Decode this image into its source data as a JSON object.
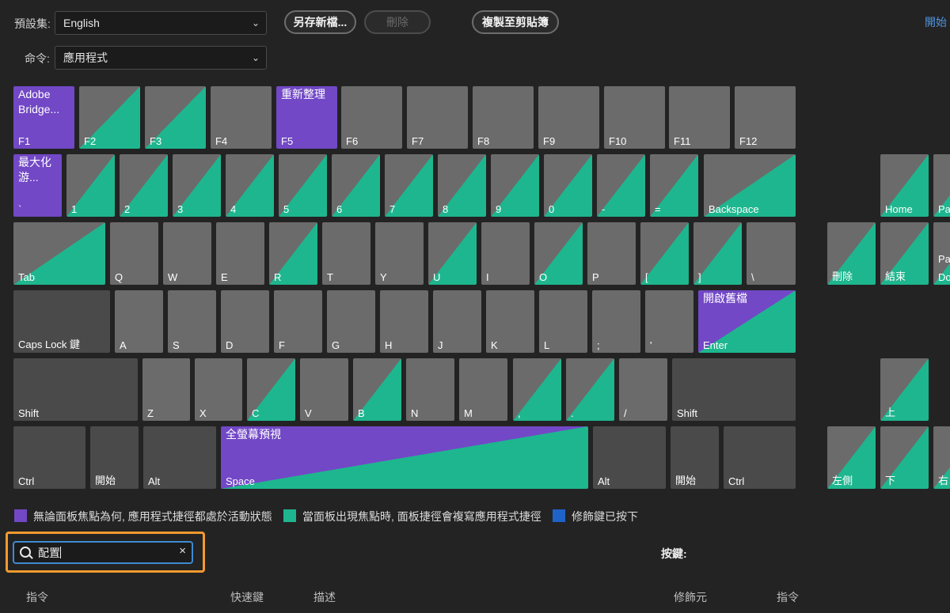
{
  "toolbar": {
    "preset_label": "預設集:",
    "preset_value": "English",
    "command_label": "命令:",
    "command_value": "應用程式",
    "save_as": "另存新檔...",
    "delete": "刪除",
    "copy_clipboard": "複製至剪貼簿",
    "start_link": "開始"
  },
  "keys": {
    "f1": "F1",
    "f1_cmd": "Adobe Bridge...",
    "f2": "F2",
    "f3": "F3",
    "f4": "F4",
    "f5": "F5",
    "f5_cmd": "重新整理",
    "f6": "F6",
    "f7": "F7",
    "f8": "F8",
    "f9": "F9",
    "f10": "F10",
    "f11": "F11",
    "f12": "F12",
    "grave": "`",
    "grave_cmd": "最大化游...",
    "n1": "1",
    "n2": "2",
    "n3": "3",
    "n4": "4",
    "n5": "5",
    "n6": "6",
    "n7": "7",
    "n8": "8",
    "n9": "9",
    "n0": "0",
    "minus": "-",
    "equal": "=",
    "backspace": "Backspace",
    "tab": "Tab",
    "q": "Q",
    "w": "W",
    "e": "E",
    "r": "R",
    "t": "T",
    "y": "Y",
    "u": "U",
    "i": "I",
    "o": "O",
    "p": "P",
    "lbracket": "[",
    "rbracket": "]",
    "backslash": "\\",
    "caps": "Caps Lock 鍵",
    "a": "A",
    "s": "S",
    "d": "D",
    "f": "F",
    "g": "G",
    "h": "H",
    "j": "J",
    "k": "K",
    "l": "L",
    "semicolon": ";",
    "quote": "'",
    "enter": "Enter",
    "enter_cmd": "開啟舊檔",
    "lshift": "Shift",
    "z": "Z",
    "x": "X",
    "c": "C",
    "v": "V",
    "b": "B",
    "n": "N",
    "m": "M",
    "comma": ",",
    "period": ".",
    "slash": "/",
    "rshift": "Shift",
    "lctrl": "Ctrl",
    "lwin": "開始",
    "lalt": "Alt",
    "space": "Space",
    "space_cmd": "全螢幕預視",
    "ralt": "Alt",
    "rwin": "開始",
    "rctrl": "Ctrl",
    "home": "Home",
    "pgup": "Pa",
    "del": "刪除",
    "end": "結束",
    "pgdn_top": "Pag",
    "pgdn_bot": "Do",
    "up": "上",
    "left": "左側",
    "down": "下",
    "right": "右"
  },
  "legend": {
    "app": "無論面板焦點為何, 應用程式捷徑都處於活動狀態",
    "panel": "當面板出現焦點時, 面板捷徑會複寫應用程式捷徑",
    "modifier": "修飾鍵已按下"
  },
  "colors": {
    "app": "#7248c6",
    "panel": "#1eb68e",
    "modifier": "#1f63c9",
    "highlight": "#f39a2e",
    "focus": "#3f8ad2"
  },
  "search": {
    "value": "配置",
    "clear": "×"
  },
  "right_panel": {
    "key_label": "按鍵:"
  },
  "table_headers": {
    "command": "指令",
    "shortcut": "快速鍵",
    "description": "描述",
    "modifier": "修飾元",
    "command2": "指令"
  }
}
